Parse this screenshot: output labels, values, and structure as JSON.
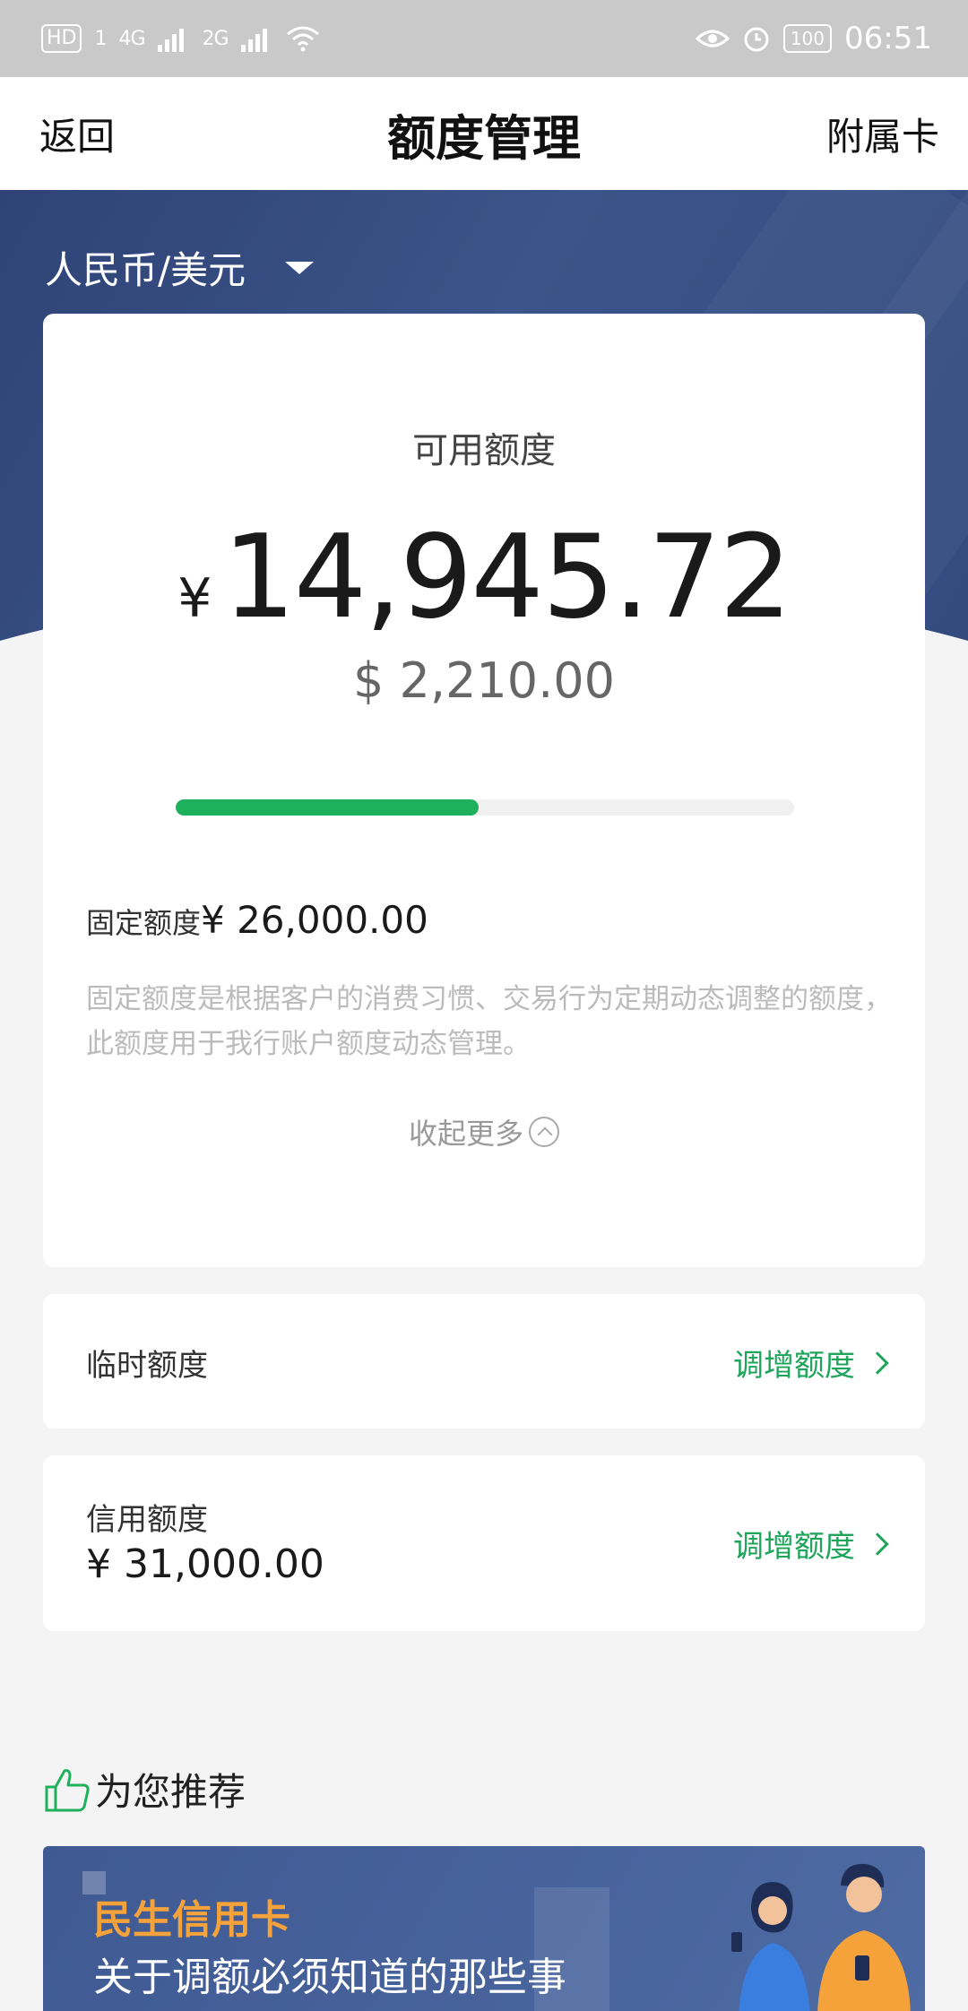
{
  "status_bar": {
    "hd": "HD",
    "sim1": "1",
    "net1": "4G",
    "net2": "2G",
    "battery": "100",
    "time": "06:51"
  },
  "nav": {
    "back": "返回",
    "title": "额度管理",
    "right": "附属卡"
  },
  "currency_selector": "人民币/美元",
  "available": {
    "label": "可用额度",
    "cny_symbol": "¥",
    "cny_amount": "14,945.72",
    "usd_amount": "$ 2,210.00",
    "progress_fraction": 0.49
  },
  "fixed": {
    "label": "固定额度",
    "value": "¥ 26,000.00",
    "description": "固定额度是根据客户的消费习惯、交易行为定期动态调整的额度，此额度用于我行账户额度动态管理。",
    "collapse": "收起更多"
  },
  "temporary": {
    "label": "临时额度",
    "action": "调增额度"
  },
  "credit": {
    "label": "信用额度",
    "value": "¥ 31,000.00",
    "action": "调增额度"
  },
  "recommend": {
    "title": "为您推荐",
    "banner_brand": "民生信用卡",
    "banner_title": "关于调额必须知道的那些事"
  },
  "colors": {
    "accent_green": "#1fb05c",
    "hero_blue": "#3b5489",
    "banner_orange": "#f6a23b"
  }
}
